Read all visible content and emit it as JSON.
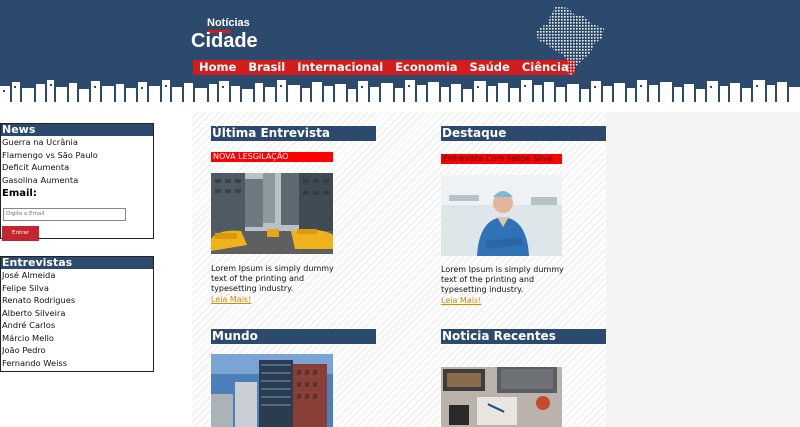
{
  "header": {
    "logo_small": "Notícias",
    "logo_big": "Cidade",
    "nav": [
      "Home",
      "Brasil",
      "Internacional",
      "Economia",
      "Saúde",
      "Ciência"
    ]
  },
  "sidebar": {
    "news": {
      "title": "News",
      "items": [
        "Guerra na Ucrânia",
        "Flamengo vs São Paulo",
        "Deficit Aumenta",
        "Gasolina Aumenta"
      ],
      "email_label": "Email:",
      "email_placeholder": "Digite o Email",
      "submit_label": "Entrar"
    },
    "interviews": {
      "title": "Entrevistas",
      "items": [
        "José Almeida",
        "Felipe Silva",
        "Renato Rodrigues",
        "Alberto Silveira",
        "André Carlos",
        "Márcio Mello",
        "João Pedro",
        "Fernando Weiss"
      ]
    }
  },
  "articles": {
    "interview": {
      "title": "Última Entrevista",
      "tag": "NOVA LESGILAÇÃO",
      "excerpt": "Lorem Ipsum is simply dummy text of the printing and typesetting industry.",
      "more": "Leia Mais!"
    },
    "featured": {
      "title": "Destaque",
      "tag": "Entrevista Com Felipe Silva",
      "excerpt": "Lorem Ipsum is simply dummy text of the printing and typesetting industry.",
      "more": "Leia Mais!"
    },
    "world": {
      "title": "Mundo"
    },
    "recent": {
      "title": "Noticia Recentes"
    }
  },
  "colors": {
    "primary": "#2c4a6e",
    "accent": "#d41c1c",
    "link": "#d88a00"
  }
}
